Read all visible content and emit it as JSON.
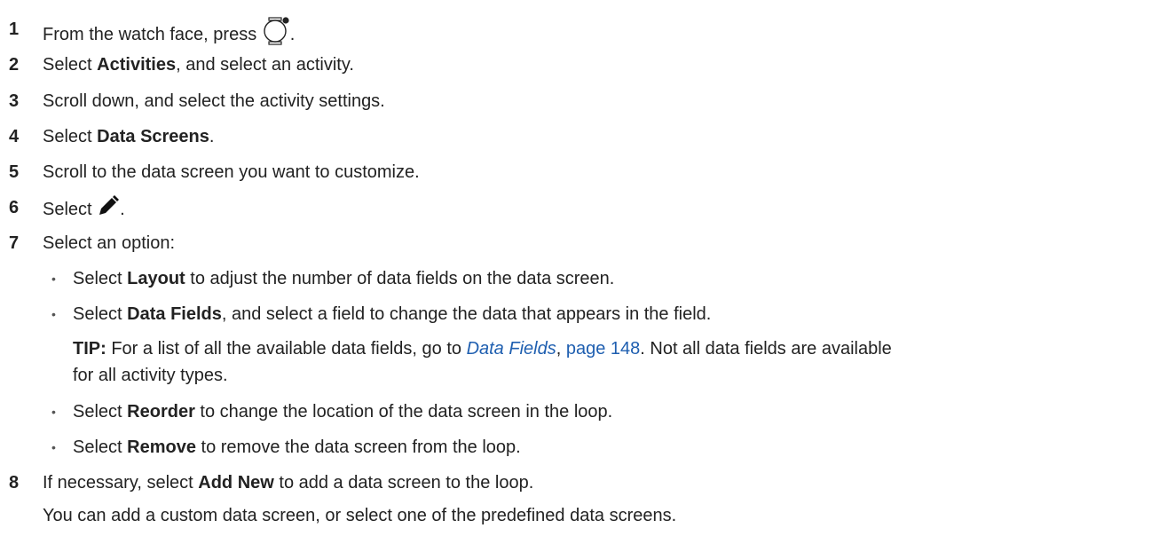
{
  "steps": [
    {
      "num": "1",
      "pre": "From the watch face, press ",
      "post": ".",
      "icon": "watch-button-icon"
    },
    {
      "num": "2",
      "pre": "Select ",
      "bold": "Activities",
      "post": ", and select an activity."
    },
    {
      "num": "3",
      "text": "Scroll down, and select the activity settings."
    },
    {
      "num": "4",
      "pre": "Select ",
      "bold": "Data Screens",
      "post": "."
    },
    {
      "num": "5",
      "text": "Scroll to the data screen you want to customize."
    },
    {
      "num": "6",
      "pre": "Select ",
      "post": ".",
      "icon": "pencil-icon"
    },
    {
      "num": "7",
      "text": "Select an option:"
    },
    {
      "num": "8",
      "pre": "If necessary, select ",
      "bold": "Add New",
      "post": " to add a data screen to the loop."
    }
  ],
  "options": [
    {
      "pre": "Select ",
      "bold": "Layout",
      "post": " to adjust the number of data fields on the data screen."
    },
    {
      "pre": "Select ",
      "bold": "Data Fields",
      "post": ", and select a field to change the data that appears in the field."
    },
    {
      "pre": "Select ",
      "bold": "Reorder",
      "post": " to change the location of the data screen in the loop."
    },
    {
      "pre": "Select ",
      "bold": "Remove",
      "post": " to remove the data screen from the loop."
    }
  ],
  "tip": {
    "label": "TIP:",
    "pre": " For a list of all the available data fields, go to ",
    "link": "Data Fields",
    "comma": ", ",
    "page": "page 148",
    "post": ". Not all data fields are available",
    "line2": "for all activity types."
  },
  "step8_note": "You can add a custom data screen, or select one of the predefined data screens.",
  "colors": {
    "text": "#222222",
    "link": "#1f5fb0"
  }
}
